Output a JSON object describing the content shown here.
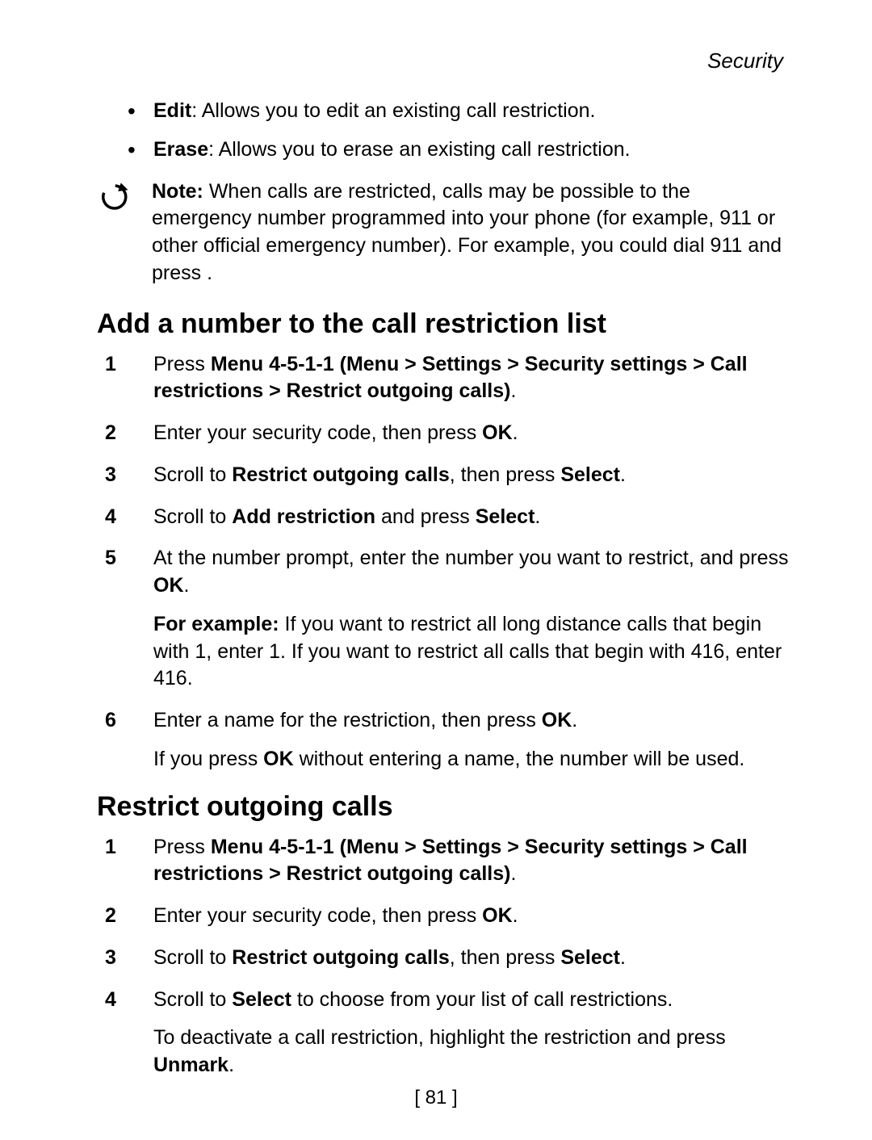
{
  "header": {
    "running_head": "Security"
  },
  "bullets": {
    "edit_label": "Edit",
    "edit_text": ": Allows you to edit an existing call restriction.",
    "erase_label": "Erase",
    "erase_text": ": Allows you to erase an existing call restriction."
  },
  "note": {
    "label": "Note:",
    "text": " When calls are restricted, calls may be possible to the emergency number programmed into your phone (for example, 911 or other official emergency number). For example, you could dial 911 and press ."
  },
  "section_a": {
    "title": "Add a number to the call restriction list",
    "steps": {
      "s1_pre": "Press ",
      "s1_bold": "Menu 4-5-1-1 (Menu > Settings > Security settings > Call restrictions > Restrict outgoing calls)",
      "s1_post": ".",
      "s2_pre": "Enter your security code, then press ",
      "s2_bold": "OK",
      "s2_post": ".",
      "s3_pre": "Scroll to ",
      "s3_bold1": "Restrict outgoing calls",
      "s3_mid": ", then press ",
      "s3_bold2": "Select",
      "s3_post": ".",
      "s4_pre": "Scroll to ",
      "s4_bold1": "Add restriction",
      "s4_mid": " and press ",
      "s4_bold2": "Select",
      "s4_post": ".",
      "s5_pre": "At the number prompt, enter the number you want to restrict, and press ",
      "s5_bold": "OK",
      "s5_post": ".",
      "s5_ex_label": "For example:",
      "s5_ex_text": " If you want to restrict all long distance calls that begin with 1, enter 1. If you want to restrict all calls that begin with 416, enter 416.",
      "s6_pre": "Enter a name for the restriction, then press ",
      "s6_bold": "OK",
      "s6_post": ".",
      "s6_extra_pre": "If you press ",
      "s6_extra_bold": "OK",
      "s6_extra_post": " without entering a name, the number will be used."
    }
  },
  "section_b": {
    "title": "Restrict outgoing calls",
    "steps": {
      "s1_pre": "Press ",
      "s1_bold": "Menu 4-5-1-1 (Menu > Settings > Security settings > Call restrictions > Restrict outgoing calls)",
      "s1_post": ".",
      "s2_pre": "Enter your security code, then press ",
      "s2_bold": "OK",
      "s2_post": ".",
      "s3_pre": "Scroll to ",
      "s3_bold1": "Restrict outgoing calls",
      "s3_mid": ", then press ",
      "s3_bold2": "Select",
      "s3_post": ".",
      "s4_pre": "Scroll to ",
      "s4_bold": "Select",
      "s4_post": " to choose from your list of call restrictions.",
      "s4_extra_pre": "To deactivate a call restriction, highlight the restriction and press ",
      "s4_extra_bold": "Unmark",
      "s4_extra_post": "."
    }
  },
  "footer": {
    "page_num": "[ 81 ]"
  }
}
